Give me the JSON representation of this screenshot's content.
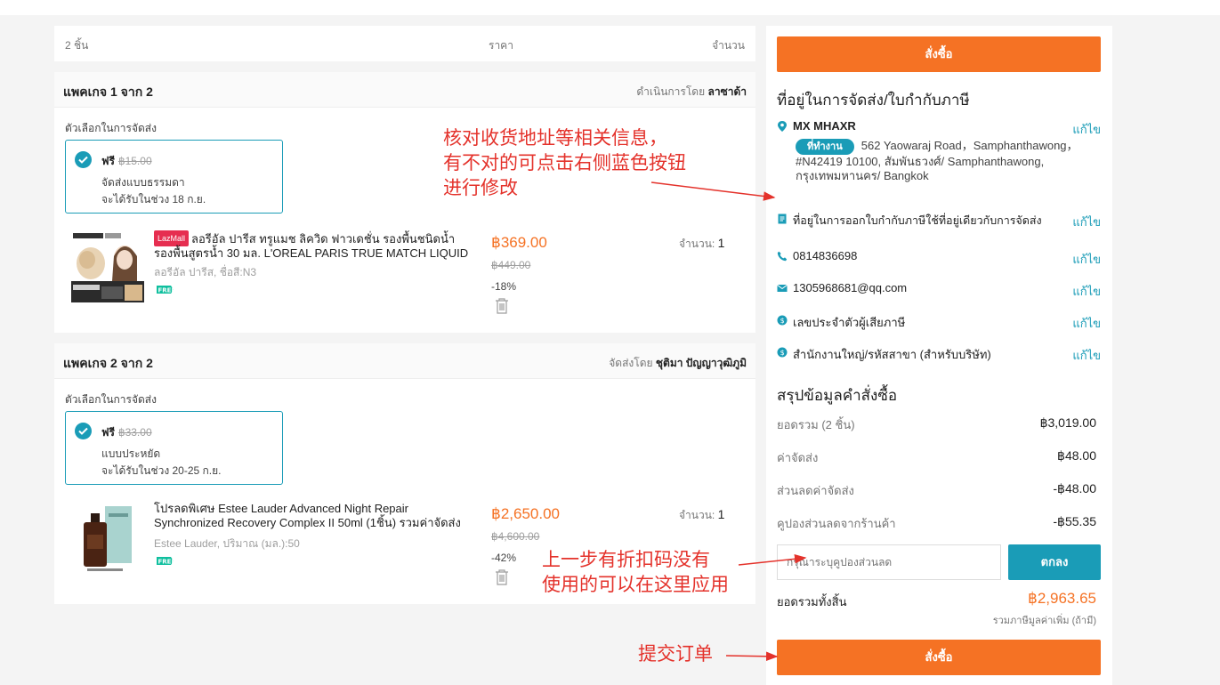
{
  "header": {
    "items_count": "2 ชิ้น",
    "price_col": "ราคา",
    "qty_col": "จำนวน"
  },
  "packages": [
    {
      "title": "แพคเกจ 1 จาก 2",
      "seller_prefix": "ดำเนินการโดย",
      "seller": "ลาซาด้า",
      "ship_label": "ตัวเลือกในการจัดส่ง",
      "ship_free": "ฟรี",
      "ship_orig": "฿15.00",
      "ship_method": "จัดส่งแบบธรรมดา",
      "ship_eta": "จะได้รับในช่วง 18 ก.ย.",
      "badge": "LazMall",
      "product_name": "ลอรีอัล ปารีส ทรูแมช ลิควิด ฟาวเดชั่น รองพื้นชนิดน้ำ รองพื้นสูตรน้ำ 30 มล. L'OREAL PARIS TRUE MATCH LIQUID",
      "variant": "ลอรีอัล ปารีส, ชื่อสี:N3",
      "free_tag": "FREE",
      "price": "฿369.00",
      "orig_price": "฿449.00",
      "discount": "-18%",
      "qty_label": "จำนวน:",
      "qty": "1"
    },
    {
      "title": "แพคเกจ 2 จาก 2",
      "seller_prefix": "จัดส่งโดย",
      "seller": "ชุติมา ปัญญาวุฒิภูมิ",
      "ship_label": "ตัวเลือกในการจัดส่ง",
      "ship_free": "ฟรี",
      "ship_orig": "฿33.00",
      "ship_method": "แบบประหยัด",
      "ship_eta": "จะได้รับในช่วง 20-25 ก.ย.",
      "product_name": "โปรลดพิเศษ Estee Lauder Advanced Night Repair Synchronized Recovery Complex II 50ml (1ชิ้น) รวมค่าจัดส่ง",
      "variant": "Estee Lauder, ปริมาณ (มล.):50",
      "free_tag": "FREE",
      "price": "฿2,650.00",
      "orig_price": "฿4,600.00",
      "discount": "-42%",
      "qty_label": "จำนวน:",
      "qty": "1"
    }
  ],
  "sidebar": {
    "order_button": "สั่งซื้อ",
    "address_title": "ที่อยู่ในการจัดส่ง/ใบกำกับภาษี",
    "name": "MX MHAXR",
    "office_tag": "ที่ทำงาน",
    "address": "562 Yaowaraj Road，Samphanthawong，#N42419 10100, สัมพันธวงศ์/ Samphanthawong, กรุงเทพมหานคร/ Bangkok",
    "edit": "แก้ไข",
    "invoice_same": "ที่อยู่ในการออกใบกำกับภาษีใช้ที่อยู่เดียวกับการจัดส่ง",
    "phone": "0814836698",
    "email": "1305968681@qq.com",
    "tax_id": "เลขประจำตัวผู้เสียภาษี",
    "branch": "สำนักงานใหญ่/รหัสสาขา (สำหรับบริษัท)",
    "summary_title": "สรุปข้อมูลคำสั่งซื้อ",
    "subtotal_label": "ยอดรวม (2 ชิ้น)",
    "subtotal": "฿3,019.00",
    "shipping_label": "ค่าจัดส่ง",
    "shipping": "฿48.00",
    "ship_disc_label": "ส่วนลดค่าจัดส่ง",
    "ship_disc": "-฿48.00",
    "store_coupon_label": "คูปองส่วนลดจากร้านค้า",
    "store_coupon": "-฿55.35",
    "voucher_placeholder": "กรุณาระบุคูปองส่วนลด",
    "apply_button": "ตกลง",
    "total_label": "ยอดรวมทั้งสิ้น",
    "total": "฿2,963.65",
    "vat_note": "รวมภาษีมูลค่าเพิ่ม (ถ้ามี)"
  },
  "annotations": {
    "check_address": [
      "核对收货地址等相关信息，",
      "有不对的可点击右侧蓝色按钮",
      "进行修改"
    ],
    "discount_code": [
      "上一步有折扣码没有",
      "使用的可以在这里应用"
    ],
    "submit": "提交订单"
  },
  "colors": {
    "accent": "#f57224",
    "link": "#1a9cb7",
    "annotation": "#e4322b"
  }
}
